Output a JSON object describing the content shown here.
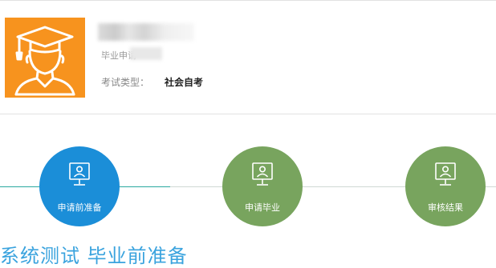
{
  "profile": {
    "name": "",
    "graduation_label": "毕业申请",
    "exam_type_label": "考试类型：",
    "exam_type_value": "社会自考",
    "avatar_icon": "graduate-avatar-icon"
  },
  "steps": [
    {
      "label": "申请前准备",
      "icon": "monitor-user-icon",
      "status": "active"
    },
    {
      "label": "申请毕业",
      "icon": "monitor-user-icon",
      "status": "pending"
    },
    {
      "label": "审核结果",
      "icon": "monitor-user-icon",
      "status": "pending"
    }
  ],
  "bottom": {
    "heading": "系统测试 毕业前准备"
  },
  "colors": {
    "avatar_bg": "#f7931e",
    "step_active": "#1b8ed8",
    "step_pending": "#78a45e",
    "track_active": "#2aa8a0",
    "heading": "#3aa3de"
  }
}
